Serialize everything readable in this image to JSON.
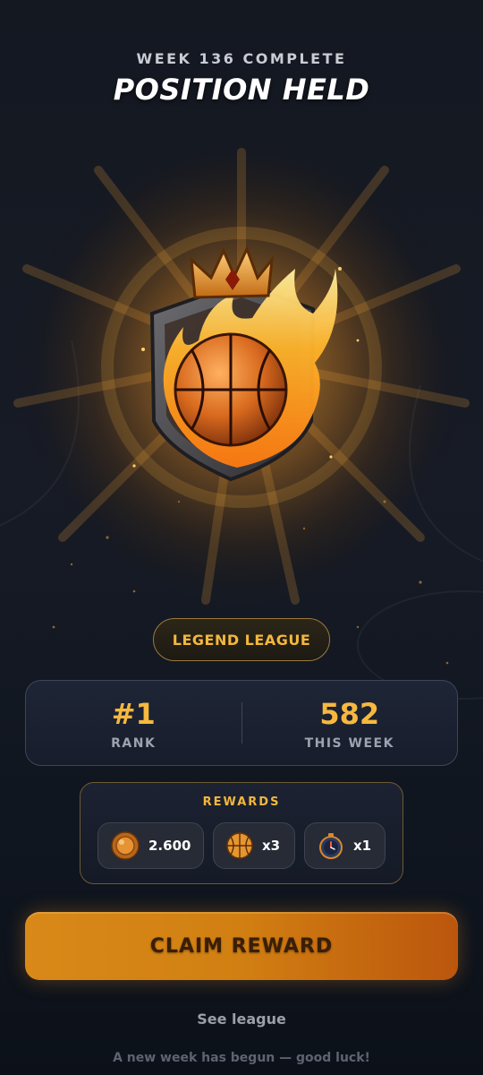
{
  "header": {
    "subtitle": "WEEK 136 COMPLETE",
    "title": "POSITION HELD"
  },
  "emblem": {
    "icon": "flaming-basketball-crown-badge-icon"
  },
  "league": {
    "label": "LEGEND LEAGUE"
  },
  "stats": {
    "rank": {
      "value": "#1",
      "label": "RANK"
    },
    "week": {
      "value": "582",
      "label": "THIS WEEK"
    }
  },
  "rewards": {
    "label": "REWARDS",
    "items": [
      {
        "icon": "coin-icon",
        "amount": "2.600"
      },
      {
        "icon": "basketball-icon",
        "amount": "x3"
      },
      {
        "icon": "stopwatch-icon",
        "amount": "x1"
      }
    ]
  },
  "actions": {
    "claim_label": "CLAIM REWARD",
    "see_league_label": "See league"
  },
  "footer": {
    "note": "A new week has begun — good luck!"
  },
  "colors": {
    "accent": "#f4b73c",
    "button": "#d88918",
    "background": "#141821"
  }
}
